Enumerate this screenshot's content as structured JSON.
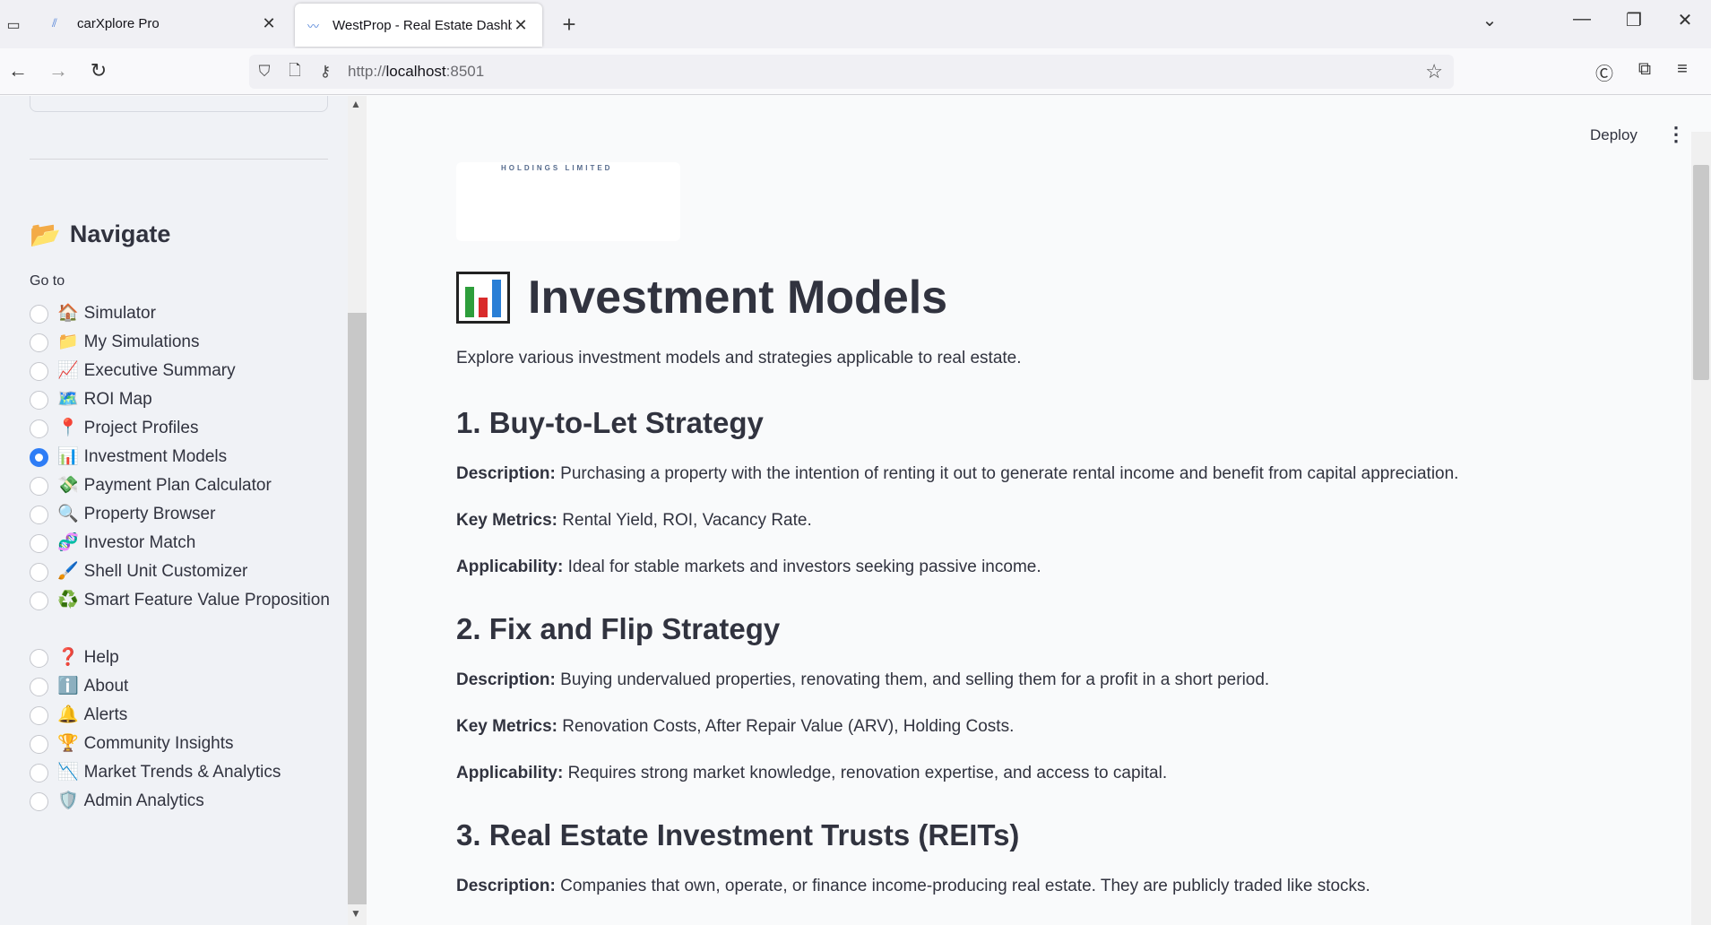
{
  "browser": {
    "tabs": [
      {
        "title": "carXplore Pro",
        "active": false
      },
      {
        "title": "WestProp - Real Estate Dashboard",
        "active": true
      }
    ],
    "url_prefix": "http://",
    "url_host": "localhost",
    "url_suffix": ":8501"
  },
  "sidebar": {
    "title": "Navigate",
    "title_icon": "folder-icon",
    "goto_label": "Go to",
    "items": [
      {
        "emoji": "🏠",
        "label": "Simulator",
        "selected": false
      },
      {
        "emoji": "📁",
        "label": "My Simulations",
        "selected": false
      },
      {
        "emoji": "📈",
        "label": "Executive Summary",
        "selected": false
      },
      {
        "emoji": "🗺️",
        "label": "ROI Map",
        "selected": false
      },
      {
        "emoji": "📍",
        "label": "Project Profiles",
        "selected": false
      },
      {
        "emoji": "📊",
        "label": "Investment Models",
        "selected": true
      },
      {
        "emoji": "💸",
        "label": "Payment Plan Calculator",
        "selected": false
      },
      {
        "emoji": "🔍",
        "label": "Property Browser",
        "selected": false
      },
      {
        "emoji": "🧬",
        "label": "Investor Match",
        "selected": false
      },
      {
        "emoji": "🖌️",
        "label": "Shell Unit Customizer",
        "selected": false
      },
      {
        "emoji": "♻️",
        "label": "Smart Feature Value Proposition",
        "selected": false
      },
      {
        "emoji": "❓",
        "label": "Help",
        "selected": false
      },
      {
        "emoji": "ℹ️",
        "label": "About",
        "selected": false
      },
      {
        "emoji": "🔔",
        "label": "Alerts",
        "selected": false
      },
      {
        "emoji": "🏆",
        "label": "Community Insights",
        "selected": false
      },
      {
        "emoji": "📉",
        "label": "Market Trends & Analytics",
        "selected": false
      },
      {
        "emoji": "🛡️",
        "label": "Admin Analytics",
        "selected": false
      }
    ]
  },
  "main": {
    "deploy_label": "Deploy",
    "logo_text": "HOLDINGS LIMITED",
    "title": "Investment Models",
    "intro": "Explore various investment models and strategies applicable to real estate.",
    "sections": [
      {
        "heading": "1. Buy-to-Let Strategy",
        "description_label": "Description:",
        "description": "Purchasing a property with the intention of renting it out to generate rental income and benefit from capital appreciation.",
        "metrics_label": "Key Metrics:",
        "metrics": "Rental Yield, ROI, Vacancy Rate.",
        "applicability_label": "Applicability:",
        "applicability": "Ideal for stable markets and investors seeking passive income."
      },
      {
        "heading": "2. Fix and Flip Strategy",
        "description_label": "Description:",
        "description": "Buying undervalued properties, renovating them, and selling them for a profit in a short period.",
        "metrics_label": "Key Metrics:",
        "metrics": "Renovation Costs, After Repair Value (ARV), Holding Costs.",
        "applicability_label": "Applicability:",
        "applicability": "Requires strong market knowledge, renovation expertise, and access to capital."
      },
      {
        "heading": "3. Real Estate Investment Trusts (REITs)",
        "description_label": "Description:",
        "description": "Companies that own, operate, or finance income-producing real estate. They are publicly traded like stocks."
      }
    ]
  },
  "colors": {
    "accent": "#2e7df6",
    "sidebar_bg": "#f0f2f6",
    "main_bg": "#f9fafb",
    "text": "#31333f"
  }
}
